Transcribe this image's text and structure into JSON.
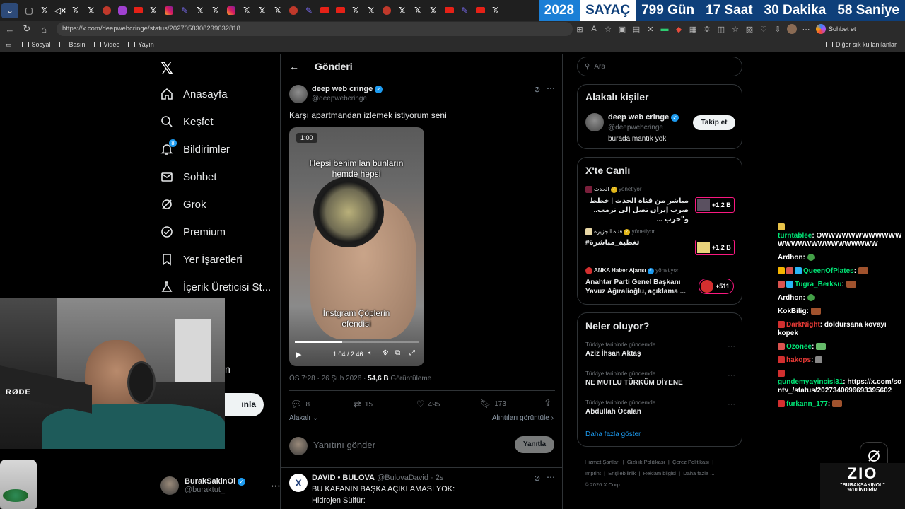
{
  "counter": {
    "year": "2028",
    "label": "SAYAÇ",
    "days": "799 Gün",
    "hours": "17 Saat",
    "minutes": "30 Dakika",
    "seconds": "58 Saniye"
  },
  "browser": {
    "url": "https://x.com/deepwebcringe/status/2027058308239032818",
    "copilot_label": "Sohbet et"
  },
  "bookmarks": {
    "items": [
      "Sosyal",
      "Basın",
      "Video",
      "Yayın"
    ],
    "other": "Diğer sık kullanılanlar"
  },
  "nav": {
    "items": [
      "Anasayfa",
      "Keşfet",
      "Bildirimler",
      "Sohbet",
      "Grok",
      "Premium",
      "Yer İşaretleri",
      "İçerik Üreticisi St..."
    ],
    "notif_count": "8",
    "post_button_partial": "ınla",
    "partial_letter": "n",
    "account": {
      "name": "BurakSakinOl",
      "handle": "@buraktut_"
    }
  },
  "post": {
    "header_title": "Gönderi",
    "author_name": "deep web cringe",
    "author_handle": "@deepwebcringe",
    "text": "Karşı apartmandan izlemek istiyorum seni",
    "video": {
      "badge": "1:00",
      "caption_top": "Hepsi benim lan bunların hemde hepsi",
      "caption_bottom": "İnstgram Çöplerin efendisi",
      "time": "1:04 / 2:46"
    },
    "meta_time": "ÖS 7:28 · 26 Şub 2026 · ",
    "meta_views": "54,6 B",
    "meta_views_label": " Görüntüleme",
    "stats": {
      "replies": "8",
      "reposts": "15",
      "likes": "495",
      "bookmarks": "173"
    },
    "related_label": "Alakalı",
    "quotes_label": "Alıntıları görüntüle",
    "reply_placeholder": "Yanıtını gönder",
    "reply_button": "Yanıtla"
  },
  "reply_tweet": {
    "author_name": "DAVID • BULOVA",
    "author_handle": "@BulovaDavid",
    "time": "· 2s",
    "line1": "BU KAFANIN BAŞKA AÇIKLAMASI YOK:",
    "line2": "Hidrojen Sülfür:"
  },
  "right": {
    "search_placeholder": "Ara",
    "relevant": {
      "title": "Alakalı kişiler",
      "name": "deep web cringe",
      "handle": "@deepwebcringe",
      "bio": "burada mantık yok",
      "follow": "Takip et"
    },
    "live": {
      "title": "X'te Canlı",
      "items": [
        {
          "host": "الحدث",
          "status": "yönetiyor",
          "title": "مباشر من قناة الحدث | خطط ضرب إيران تصل إلى ترمب.. و\"حرب ...",
          "count": "+1,2 B"
        },
        {
          "host": "قناة الجزيرة",
          "status": "yönetiyor",
          "title": "#تغطية_مباشرة",
          "count": "+1,2 B"
        },
        {
          "host": "ANKA Haber Ajansı",
          "status": "yönetiyor",
          "title": "Anahtar Parti Genel Başkanı Yavuz Ağıralioğlu, açıklama ...",
          "count": "+511"
        }
      ]
    },
    "trends": {
      "title": "Neler oluyor?",
      "items": [
        {
          "context": "Türkiye tarihinde gündemde",
          "name": "Aziz İhsan Aktaş"
        },
        {
          "context": "Türkiye tarihinde gündemde",
          "name": "NE MUTLU TÜRKÜM DİYENE"
        },
        {
          "context": "Türkiye tarihinde gündemde",
          "name": "Abdullah Öcalan"
        }
      ],
      "more": "Daha fazla göster"
    },
    "footer": [
      "Hizmet Şartları",
      "Gizlilik Politikası",
      "Çerez Politikası",
      "Imprint",
      "Erişilebilirlik",
      "Reklam bilgisi",
      "Daha fazla ...",
      "© 2026 X Corp."
    ]
  },
  "chat": [
    {
      "user": "turntablee",
      "msg": "OWWWWWWWWWWWWWWWWWWWWWWWWWWW",
      "color": "#00e676"
    },
    {
      "user": "Ardhon",
      "msg": "",
      "color": "#ffffff"
    },
    {
      "user": "QueenOfPlates",
      "msg": "",
      "color": "#00e676"
    },
    {
      "user": "Tugra_Berksu",
      "msg": "",
      "color": "#00e676"
    },
    {
      "user": "Ardhon",
      "msg": "",
      "color": "#ffffff"
    },
    {
      "user": "KokBilig",
      "msg": "",
      "color": "#ffffff"
    },
    {
      "user": "DarkNight",
      "msg": "doldursana kovayı kopek",
      "color": "#e53935"
    },
    {
      "user": "Ozonee",
      "msg": "",
      "color": "#00e676"
    },
    {
      "user": "hakops",
      "msg": "",
      "color": "#e53935"
    },
    {
      "user": "gundemyayincisi31",
      "msg": "https://x.com/sontv_/status/2027340696693395602",
      "color": "#00e676"
    },
    {
      "user": "furkann_177",
      "msg": "",
      "color": "#00e676"
    }
  ],
  "overlay": {
    "brand": "ZIO",
    "promo_line1": "\"BURAKSAKINOL\"",
    "promo_line2": "%10 İNDİRİM",
    "rode": "RØDE"
  }
}
